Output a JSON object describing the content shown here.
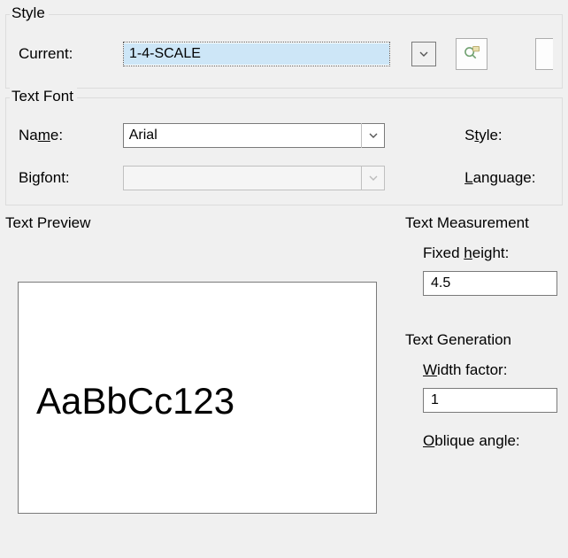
{
  "style": {
    "legend": "Style",
    "current_label": "Current:",
    "current_value": "1-4-SCALE"
  },
  "font": {
    "legend": "Text Font",
    "name_label": "Name:",
    "name_value": "Arial",
    "style_label": "Style:",
    "bigfont_label": "Bigfont:",
    "bigfont_value": "",
    "language_label": "Language:"
  },
  "preview": {
    "legend": "Text Preview",
    "sample": "AaBbCc123"
  },
  "measurement": {
    "legend": "Text Measurement",
    "height_label": "Fixed height:",
    "height_value": "4.5"
  },
  "generation": {
    "legend": "Text Generation",
    "width_label": "Width factor:",
    "width_value": "1",
    "oblique_label": "Oblique angle:"
  }
}
